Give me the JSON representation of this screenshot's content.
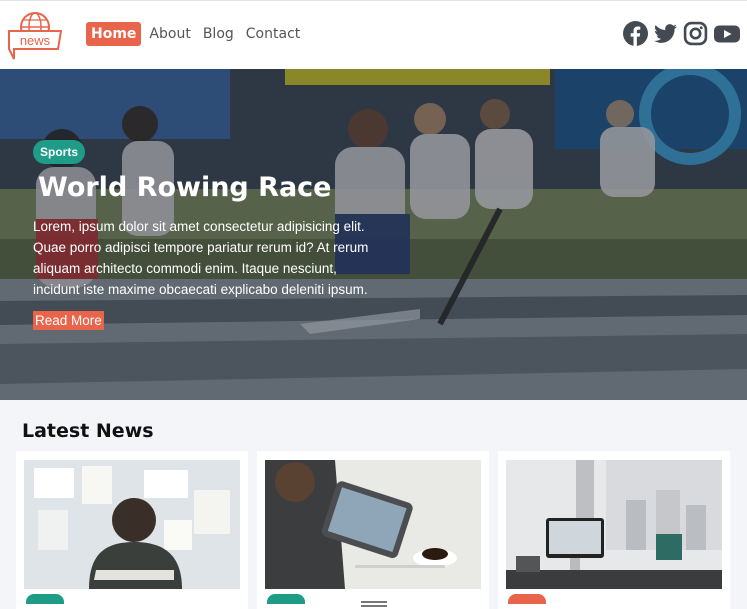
{
  "header": {
    "logo_text": "news",
    "nav": [
      {
        "label": "Home",
        "active": true
      },
      {
        "label": "About",
        "active": false
      },
      {
        "label": "Blog",
        "active": false
      },
      {
        "label": "Contact",
        "active": false
      }
    ],
    "social": [
      "facebook-icon",
      "twitter-icon",
      "instagram-icon",
      "youtube-icon"
    ]
  },
  "hero": {
    "badge": "Sports",
    "title": "World Rowing Race",
    "text": "Lorem, ipsum dolor sit amet consectetur adipisicing elit. Quae porro adipisci tempore pariatur rerum id? At rerum aliquam architecto commodi enim. Itaque nesciunt, incidunt iste maxime obcaecati explicabo deleniti ipsum.",
    "read_more": "Read More"
  },
  "latest": {
    "title": "Latest News",
    "cards": [
      {
        "tag_color": "#1f9c88"
      },
      {
        "tag_color": "#1f9c88"
      },
      {
        "tag_color": "#e8644a"
      }
    ]
  },
  "colors": {
    "accent": "#e8644a",
    "teal": "#1f9c88",
    "icon": "#444a52"
  }
}
